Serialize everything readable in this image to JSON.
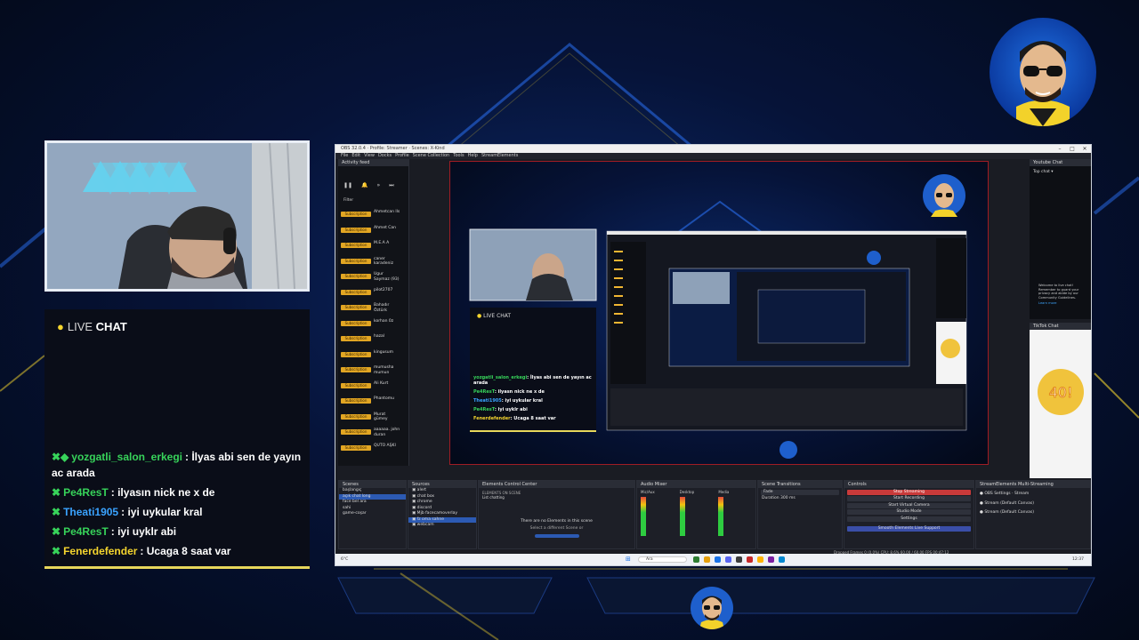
{
  "live_chat": {
    "header_prefix": "LIVE",
    "header_bold": "CHAT",
    "messages": [
      {
        "user": "yozgatli_salon_erkegi",
        "user_color": "#37d35a",
        "text": ": İlyas abi sen de yayın ac arada"
      },
      {
        "user": "Pe4ResT",
        "user_color": "#37d35a",
        "text": ": ilyasın nick ne x de"
      },
      {
        "user": "Theati1905",
        "user_color": "#3aa3ff",
        "text": ": iyi uykular kral"
      },
      {
        "user": "Pe4ResT",
        "user_color": "#37d35a",
        "text": ": iyi uyklr abi"
      },
      {
        "user": "Fenerdefender",
        "user_color": "#f5d52e",
        "text": ": Ucaga 8 saat var"
      }
    ]
  },
  "obs": {
    "title": "OBS 32.0.4 · Profile: Streamer · Scenes: X-Kind",
    "menu": [
      "File",
      "Edit",
      "View",
      "Docks",
      "Profile",
      "Scene Collection",
      "Tools",
      "Help",
      "StreamElements"
    ],
    "activity_feed": {
      "title": "Activity feed",
      "filter": "Filter",
      "items": [
        {
          "tag": "Subscription",
          "name": "Ahmetcan lls"
        },
        {
          "tag": "Subscription",
          "name": "Ahmet Can"
        },
        {
          "tag": "Subscription",
          "name": "M.E.A A"
        },
        {
          "tag": "Subscription",
          "name": "caner karadeniz"
        },
        {
          "tag": "Subscription",
          "name": "Ugur Saymaz (93)"
        },
        {
          "tag": "Subscription",
          "name": "pilot2707"
        },
        {
          "tag": "Subscription",
          "name": "Bahadır Öztürk"
        },
        {
          "tag": "Subscription",
          "name": "korhan 0z"
        },
        {
          "tag": "Subscription",
          "name": "hazal"
        },
        {
          "tag": "Subscription",
          "name": "kingusum"
        },
        {
          "tag": "Subscription",
          "name": "mumusha mumun"
        },
        {
          "tag": "Subscription",
          "name": "Ali Kurt"
        },
        {
          "tag": "Subscription",
          "name": "Phantomu"
        },
        {
          "tag": "Subscription",
          "name": "Murat gümey"
        },
        {
          "tag": "Subscription",
          "name": "aaaaaa. john duran"
        },
        {
          "tag": "Subscription",
          "name": "QUTO AŞKI"
        }
      ]
    },
    "preview_chat": {
      "header": "LIVE CHAT",
      "messages": [
        {
          "user": "yozgatli_salon_erkegi",
          "text": ": İlyas abi sen de yayın ac arada"
        },
        {
          "user": "Pe4ResT",
          "text": ": ilyasn nick ne x de"
        },
        {
          "user": "Theati1905",
          "text": ": iyi uykular kral"
        },
        {
          "user": "Pe4ResT",
          "text": ": iyi uyklr abi"
        },
        {
          "user": "Fenerdefender",
          "text": ": Ucaga 8 saat var"
        }
      ]
    },
    "youtube_chat": {
      "title": "Youtube Chat",
      "top_chat": "Top chat ▾",
      "welcome": "Welcome to live chat! Remember to guard your privacy and abide by our Community Guidelines.",
      "learn_more": "Learn more"
    },
    "tiktok_chat": {
      "title": "TikTok Chat"
    },
    "scenes": {
      "title": "Scenes",
      "items": [
        "başlangıç",
        "açık chat long",
        "face bel ara",
        "sahi",
        "game-coşar"
      ]
    },
    "sources": {
      "title": "Sources",
      "items": [
        "alert",
        "chat box",
        "chrome",
        "discord",
        "Mjb facecamoverlay",
        "fz oma sahne",
        "webcam"
      ]
    },
    "elements": {
      "title": "Elements Control Center",
      "on_scene": "ELEMENTS ON SCENE",
      "scene_name": "List chatting",
      "empty": "There are no Elements in this scene",
      "hint": "Select a different Scene or"
    },
    "mixer": {
      "title": "Audio Mixer",
      "channels": [
        "Mic/Aux",
        "Desktop",
        "Media"
      ]
    },
    "transitions": {
      "title": "Scene Transitions",
      "type": "Fade",
      "duration_label": "Duration",
      "duration": "300 ms"
    },
    "controls": {
      "title": "Controls",
      "buttons": [
        "Stop Streaming",
        "Start Recording",
        "Start Virtual Camera",
        "Studio Mode",
        "Settings"
      ],
      "footer": "Smooth Elements Live Support"
    },
    "multistream": {
      "title": "StreamElements Multi-Streaming",
      "rows": [
        "OBS Settings · Stream",
        "Stream (Default Canvas)",
        "Stream (Default Canvas)"
      ]
    },
    "status": "Dropped Frames 0 (0.0%)   CPU: 8.6%   60.00 / 60.00 FPS   00:47:12",
    "taskbar": {
      "search": "Ara",
      "time": "12:37",
      "weather": "6°C"
    }
  }
}
